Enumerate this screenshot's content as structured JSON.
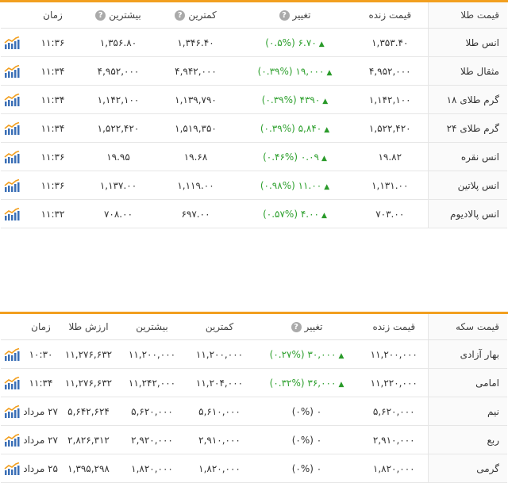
{
  "gold": {
    "headers": {
      "name": "قیمت طلا",
      "live": "قیمت زنده",
      "change": "تغییر",
      "low": "کمترین",
      "high": "بیشترین",
      "time": "زمان"
    },
    "rows": [
      {
        "name": "انس طلا",
        "live": "۱,۳۵۳.۴۰",
        "pct": "(۰.۵%)",
        "change": "۶.۷۰",
        "low": "۱,۳۴۶.۴۰",
        "high": "۱,۳۵۶.۸۰",
        "time": "۱۱:۳۶"
      },
      {
        "name": "مثقال طلا",
        "live": "۴,۹۵۲,۰۰۰",
        "pct": "(۰.۳۹%)",
        "change": "۱۹,۰۰۰",
        "low": "۴,۹۴۲,۰۰۰",
        "high": "۴,۹۵۲,۰۰۰",
        "time": "۱۱:۳۴"
      },
      {
        "name": "گرم طلای ۱۸",
        "live": "۱,۱۴۲,۱۰۰",
        "pct": "(۰.۳۹%)",
        "change": "۴۳۹۰",
        "low": "۱,۱۳۹,۷۹۰",
        "high": "۱,۱۴۲,۱۰۰",
        "time": "۱۱:۳۴"
      },
      {
        "name": "گرم طلای ۲۴",
        "live": "۱,۵۲۲,۴۲۰",
        "pct": "(۰.۳۹%)",
        "change": "۵,۸۴۰",
        "low": "۱,۵۱۹,۳۵۰",
        "high": "۱,۵۲۲,۴۲۰",
        "time": "۱۱:۳۴"
      },
      {
        "name": "انس نقره",
        "live": "۱۹.۸۲",
        "pct": "(۰.۴۶%)",
        "change": "۰.۰۹",
        "low": "۱۹.۶۸",
        "high": "۱۹.۹۵",
        "time": "۱۱:۳۶"
      },
      {
        "name": "انس پلاتین",
        "live": "۱,۱۳۱.۰۰",
        "pct": "(۰.۹۸%)",
        "change": "۱۱.۰۰",
        "low": "۱,۱۱۹.۰۰",
        "high": "۱,۱۳۷.۰۰",
        "time": "۱۱:۳۶"
      },
      {
        "name": "انس پالادیوم",
        "live": "۷۰۳.۰۰",
        "pct": "(۰.۵۷%)",
        "change": "۴.۰۰",
        "low": "۶۹۷.۰۰",
        "high": "۷۰۸.۰۰",
        "time": "۱۱:۳۲"
      }
    ]
  },
  "coin": {
    "headers": {
      "name": "قیمت سکه",
      "live": "قیمت زنده",
      "change": "تغییر",
      "low": "کمترین",
      "high": "بیشترین",
      "value": "ارزش طلا",
      "time": "زمان"
    },
    "rows": [
      {
        "name": "بهار آزادی",
        "live": "۱۱,۲۰۰,۰۰۰",
        "pct": "(۰.۲۷%)",
        "change": "۳۰,۰۰۰",
        "low": "۱۱,۲۰۰,۰۰۰",
        "high": "۱۱,۲۰۰,۰۰۰",
        "value": "۱۱,۲۷۶,۶۳۲",
        "time": "۱۰:۳۰"
      },
      {
        "name": "امامی",
        "live": "۱۱,۲۲۰,۰۰۰",
        "pct": "(۰.۳۲%)",
        "change": "۳۶,۰۰۰",
        "low": "۱۱,۲۰۴,۰۰۰",
        "high": "۱۱,۲۴۲,۰۰۰",
        "value": "۱۱,۲۷۶,۶۳۲",
        "time": "۱۱:۳۴"
      },
      {
        "name": "نیم",
        "live": "۵,۶۲۰,۰۰۰",
        "pct": "(۰%)",
        "change": "۰",
        "low": "۵,۶۱۰,۰۰۰",
        "high": "۵,۶۲۰,۰۰۰",
        "value": "۵,۶۴۲,۶۲۴",
        "time": "۲۷ مرداد"
      },
      {
        "name": "ربع",
        "live": "۲,۹۱۰,۰۰۰",
        "pct": "(۰%)",
        "change": "۰",
        "low": "۲,۹۱۰,۰۰۰",
        "high": "۲,۹۲۰,۰۰۰",
        "value": "۲,۸۲۶,۳۱۲",
        "time": "۲۷ مرداد"
      },
      {
        "name": "گرمی",
        "live": "۱,۸۲۰,۰۰۰",
        "pct": "(۰%)",
        "change": "۰",
        "low": "۱,۸۲۰,۰۰۰",
        "high": "۱,۸۲۰,۰۰۰",
        "value": "۱,۳۹۵,۲۹۸",
        "time": "۲۵ مرداد"
      }
    ]
  },
  "icons": {
    "help": "question-icon",
    "up": "up-arrow-icon",
    "chart": "chart-icon"
  },
  "colors": {
    "accent": "#f29f1f",
    "positive": "#2ea02e"
  }
}
